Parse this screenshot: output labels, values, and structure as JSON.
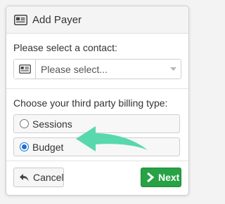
{
  "dialog": {
    "title": "Add Payer",
    "title_icon": "id-card-icon"
  },
  "contact": {
    "label": "Please select a contact:",
    "select_value": "Please select...",
    "addon_icon": "id-card-icon",
    "caret_icon": "caret-down-icon"
  },
  "billing": {
    "label": "Choose your third party billing type:",
    "options": [
      {
        "label": "Sessions",
        "checked": false
      },
      {
        "label": "Budget",
        "checked": true
      }
    ]
  },
  "footer": {
    "cancel_label": "Cancel",
    "cancel_icon": "undo-icon",
    "next_label": "Next",
    "next_icon": "chevron-right-icon"
  },
  "colors": {
    "primary_green": "#27a245",
    "annotation_arrow": "#4fd6a9",
    "radio_checked": "#1a6fd6"
  }
}
